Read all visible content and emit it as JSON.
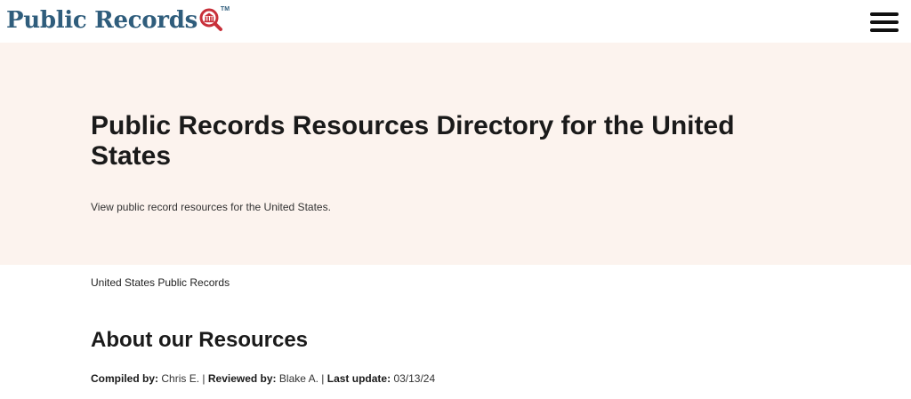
{
  "header": {
    "logo_text": "Public Records",
    "logo_tm": "TM",
    "logo_icon": "magnifier-courthouse-icon",
    "menu_icon": "hamburger-menu-icon",
    "colors": {
      "logo_blue": "#2f5d7c",
      "logo_red": "#c8303a",
      "hero_background": "#fcf3ee"
    }
  },
  "hero": {
    "title": "Public Records Resources Directory for the United States",
    "subtitle": "View public record resources for the United States."
  },
  "breadcrumb": {
    "label": "United States Public Records"
  },
  "about": {
    "title": "About our Resources",
    "compiled_label": "Compiled by:",
    "compiled_value": "Chris E.",
    "separator": "|",
    "reviewed_label": "Reviewed by:",
    "reviewed_value": "Blake A.",
    "updated_label": "Last update:",
    "updated_value": "03/13/24"
  }
}
